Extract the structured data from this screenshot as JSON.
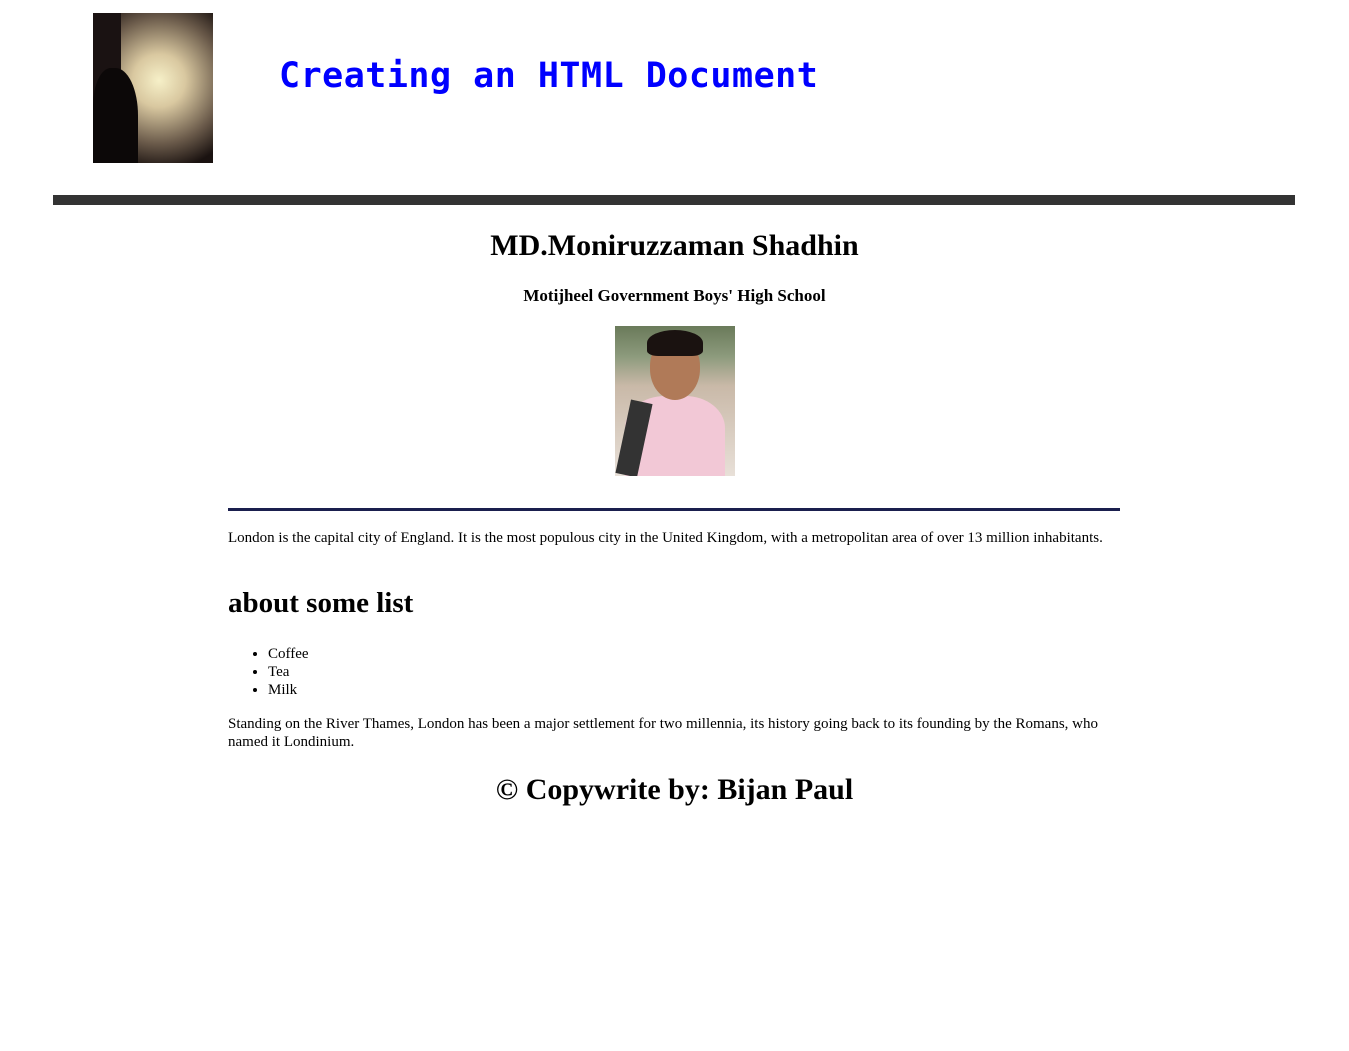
{
  "header": {
    "title": "Creating an HTML Document"
  },
  "profile": {
    "name": "MD.Moniruzzaman Shadhin",
    "school": "Motijheel Government Boys' High School"
  },
  "content": {
    "intro": "London is the capital city of England. It is the most populous city in the United Kingdom, with a metropolitan area of over 13 million inhabitants.",
    "list_heading": "about some list",
    "list_items": [
      "Coffee",
      "Tea",
      "Milk"
    ],
    "history": "Standing on the River Thames, London has been a major settlement for two millennia, its history going back to its founding by the Romans, who named it Londinium."
  },
  "footer": {
    "text": "© Copywrite by: Bijan Paul"
  },
  "colors": {
    "title": "#0000ff",
    "header_bar": "#333333",
    "rule": "#1a1f4e"
  }
}
